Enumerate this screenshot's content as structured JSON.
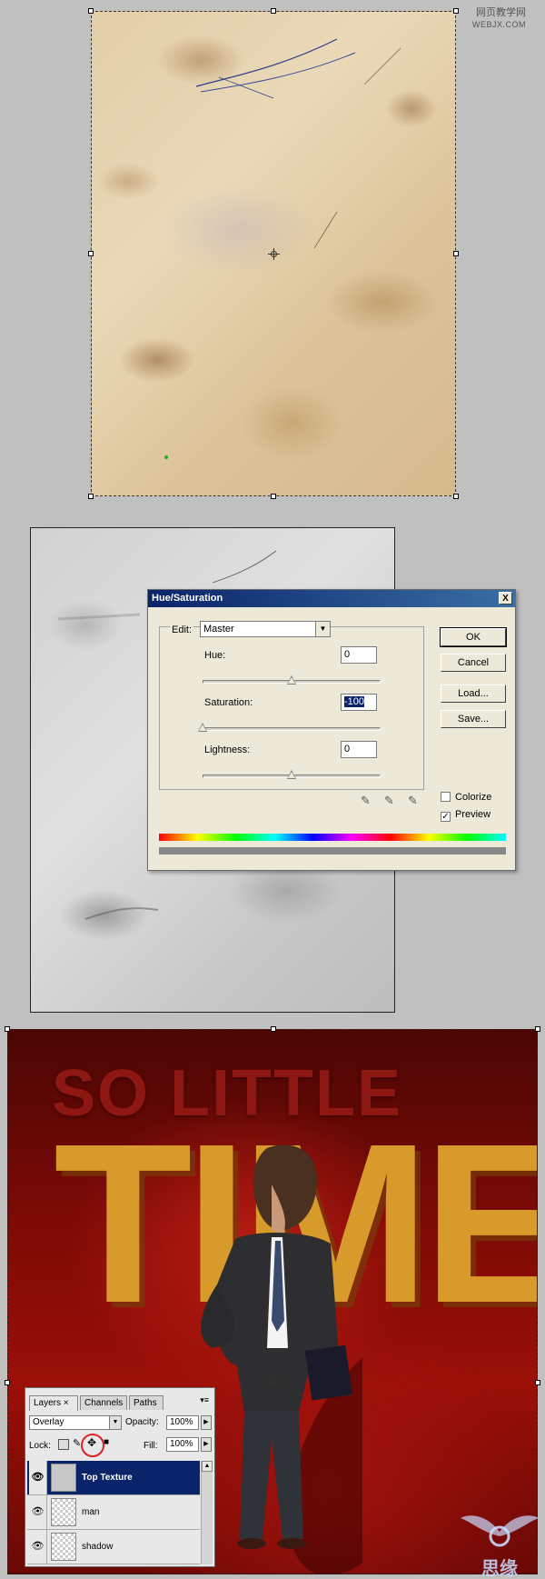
{
  "watermark_top": {
    "line1": "网页教学网",
    "line2": "WEBJX.COM"
  },
  "dialog": {
    "title": "Hue/Saturation",
    "close_glyph": "X",
    "edit_label": "Edit:",
    "edit_value": "Master",
    "hue_label": "Hue:",
    "hue_value": "0",
    "hue_fraction": 0.5,
    "saturation_label": "Saturation:",
    "saturation_value": "-100",
    "saturation_fraction": 0.0,
    "lightness_label": "Lightness:",
    "lightness_value": "0",
    "lightness_fraction": 0.5,
    "ok_label": "OK",
    "cancel_label": "Cancel",
    "load_label": "Load...",
    "save_label": "Save...",
    "colorize_label": "Colorize",
    "colorize_checked": false,
    "preview_label": "Preview",
    "preview_checked": true
  },
  "poster": {
    "line1": "SO LITTLE",
    "line2": "TIME",
    "accent_red": "#9a1008",
    "accent_gold": "#d89a2a"
  },
  "layers_panel": {
    "tabs": [
      {
        "label": "Layers ×",
        "active": true
      },
      {
        "label": "Channels",
        "active": false
      },
      {
        "label": "Paths",
        "active": false
      }
    ],
    "blend_mode": "Overlay",
    "opacity_label": "Opacity:",
    "opacity_value": "100%",
    "lock_label": "Lock:",
    "fill_label": "Fill:",
    "fill_value": "100%",
    "layers": [
      {
        "name": "Top Texture",
        "selected": true,
        "visible": true
      },
      {
        "name": "man",
        "selected": false,
        "visible": true
      },
      {
        "name": "shadow",
        "selected": false,
        "visible": true
      }
    ]
  },
  "watermark_bottom": {
    "text": "思缘"
  }
}
